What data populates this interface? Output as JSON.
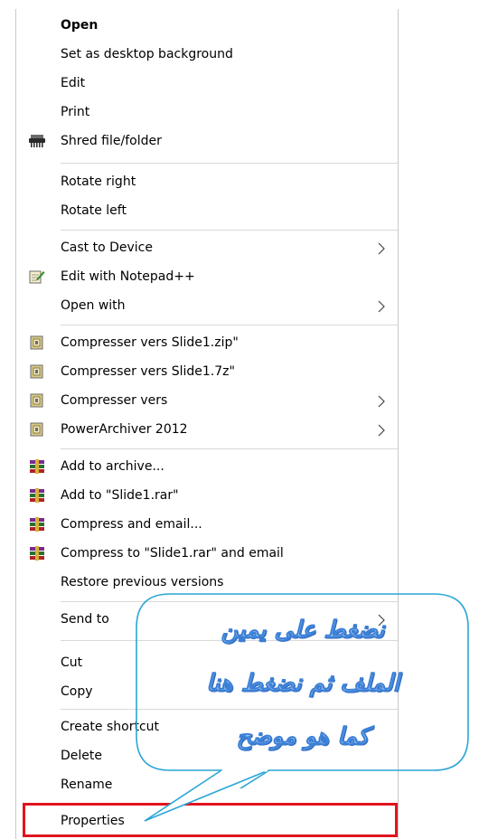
{
  "menu": {
    "items": [
      {
        "label": "Open",
        "bold": true,
        "icon": "",
        "submenu": false
      },
      {
        "label": "Set as desktop background",
        "bold": false,
        "icon": "",
        "submenu": false
      },
      {
        "label": "Edit",
        "bold": false,
        "icon": "",
        "submenu": false
      },
      {
        "label": "Print",
        "bold": false,
        "icon": "",
        "submenu": false
      },
      {
        "label": "Shred file/folder",
        "bold": false,
        "icon": "shredder-icon",
        "submenu": false
      },
      {
        "label": "Rotate right",
        "bold": false,
        "icon": "",
        "submenu": false
      },
      {
        "label": "Rotate left",
        "bold": false,
        "icon": "",
        "submenu": false
      },
      {
        "label": "Cast to Device",
        "bold": false,
        "icon": "",
        "submenu": true
      },
      {
        "label": "Edit with Notepad++",
        "bold": false,
        "icon": "notepad-plus-icon",
        "submenu": false
      },
      {
        "label": "Open with",
        "bold": false,
        "icon": "",
        "submenu": true
      },
      {
        "label": "Compresser vers Slide1.zip\"",
        "bold": false,
        "icon": "powerarchiver-icon",
        "submenu": false
      },
      {
        "label": "Compresser vers Slide1.7z\"",
        "bold": false,
        "icon": "powerarchiver-icon",
        "submenu": false
      },
      {
        "label": "Compresser vers",
        "bold": false,
        "icon": "powerarchiver-icon",
        "submenu": true
      },
      {
        "label": "PowerArchiver 2012",
        "bold": false,
        "icon": "powerarchiver-icon",
        "submenu": true
      },
      {
        "label": "Add to archive...",
        "bold": false,
        "icon": "winrar-icon",
        "submenu": false
      },
      {
        "label": "Add to \"Slide1.rar\"",
        "bold": false,
        "icon": "winrar-icon",
        "submenu": false
      },
      {
        "label": "Compress and email...",
        "bold": false,
        "icon": "winrar-icon",
        "submenu": false
      },
      {
        "label": "Compress to \"Slide1.rar\" and email",
        "bold": false,
        "icon": "winrar-icon",
        "submenu": false
      },
      {
        "label": "Restore previous versions",
        "bold": false,
        "icon": "",
        "submenu": false
      },
      {
        "label": "Send to",
        "bold": false,
        "icon": "",
        "submenu": true
      },
      {
        "label": "Cut",
        "bold": false,
        "icon": "",
        "submenu": false
      },
      {
        "label": "Copy",
        "bold": false,
        "icon": "",
        "submenu": false
      },
      {
        "label": "Create shortcut",
        "bold": false,
        "icon": "",
        "submenu": false
      },
      {
        "label": "Delete",
        "bold": false,
        "icon": "",
        "submenu": false
      },
      {
        "label": "Rename",
        "bold": false,
        "icon": "",
        "submenu": false
      },
      {
        "label": "Properties",
        "bold": false,
        "icon": "",
        "submenu": false
      }
    ]
  },
  "annotation": {
    "lines": [
      "نضغط على يمين",
      "الملف ثم نضغط هنا",
      "كما هو موضح"
    ],
    "bubble_border_color": "#2aa6d6",
    "text_color": "#9fc3f0",
    "highlight_color": "#e0141e"
  }
}
